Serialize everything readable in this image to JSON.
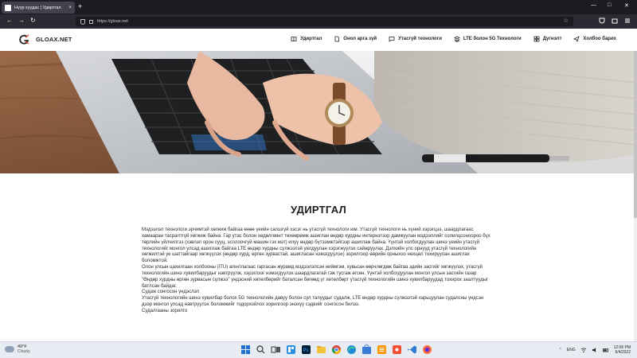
{
  "browser": {
    "tab_title": "Нүүр хуудас | Удиртгал",
    "tab_close": "×",
    "new_tab": "+",
    "url": "https://gloax.net",
    "back": "←",
    "forward": "→",
    "reload": "↻",
    "star": "☆",
    "minimize": "—",
    "maximize": "□",
    "close": "✕"
  },
  "site": {
    "logo": "GLOAX.NET",
    "menu": [
      {
        "label": "Удиртгал",
        "icon": "book-icon"
      },
      {
        "label": "Онол арга зүй",
        "icon": "document-icon"
      },
      {
        "label": "Утасгүй технологи",
        "icon": "chat-icon"
      },
      {
        "label": "LTE болон 5G Технологи",
        "icon": "layers-icon"
      },
      {
        "label": "Дүгнэлт",
        "icon": "grid-icon"
      },
      {
        "label": "Холбоо барих",
        "icon": "send-icon"
      }
    ]
  },
  "main": {
    "title": "УДИРТГАЛ",
    "paragraphs": [
      "Мэдээлэл технологи эрчимтэй хөгжиж байгаа өнөө үеийн салшгүй хэсэг нь утасгүй технологи юм. Утасгүй технологи нь хүний хэрэгцээ, шаардлагаас хамааран тасралтгүй хөгжиж байна. Гар утас болон хөдөлгөөнт төхөөрөмж ашиглан өндөр хурдны интернэтээр дамжуулан мэдээллийг солилцсоноороо бүх төрлийн үйлчилгээ (хэвлэл орон сууц, эсолоочгүй машин гэх мэт) илүү өндөр бүтээмжтэйгээр ашиглаж байна. Үүнтэй холбогдуулан шинэ үеийн утасгүй технологийг монгол улсад ашиглаж байгаа LTE өндөр хурдны сүлжээтэй уялдуулан хэрэгжүүлэх сайжруулах. Дэлхийн улс орнууд утасгүй технологийн хөгжилтэй уе шаттайгаар хөгжүүлэх (өндөр хурд, өргөн зурвастай, ашигласан нэмэгдүүлэх) зорилгоор өөрийн орныхоо нөхцөл тохируулан ашиглах боломжтой.",
      "Олон улсын цахилгаан холбооны (ITU) агентлагаас гаргасан журамд мэдээлэлсэн ниймгэм, хувьсан өөрчлөгдөж байгаа эдийн засгийг хөгжүүлэх, утасгүй технологийн шинэ хувилбаруудыг нэвтрүүлж, хэрэглээг нэмэгдүүлэх шаардлагатай гэж тусгаж өгсөн. Үүнтэй холбогдуулан монгол улсын засгийн газар \"Өндөр хурдны өргөн зурвасын сүлжээ\" үндэсний хөтөлбөрийг баталсан бөгөөд үг хөтөлбөрт утасгүй технологийн шинэ хувилбаруудад тохирох заалтуудыг батлсан байдаг.",
      "Судаж сонгосон үндэслэл",
      "Утасгүй технологийн шинэ хувилбар болох 5G технологийн давуу болон сул талуудыг судалж, LTE өндөр хурдны сүлжээтэй харьцуулан судалсны үндсэн дээр монгол улсад нэвтрүүлэх боломжийг тодорхойлох зорилгоор энэхүү сэдвийг сонгосон билээ.",
      "Судалгааны зорилго"
    ]
  },
  "taskbar": {
    "temp": "49°F",
    "weather": "Cloudy",
    "lang": "ENG",
    "time": "12:06 PM",
    "date": "6/4/2022"
  }
}
